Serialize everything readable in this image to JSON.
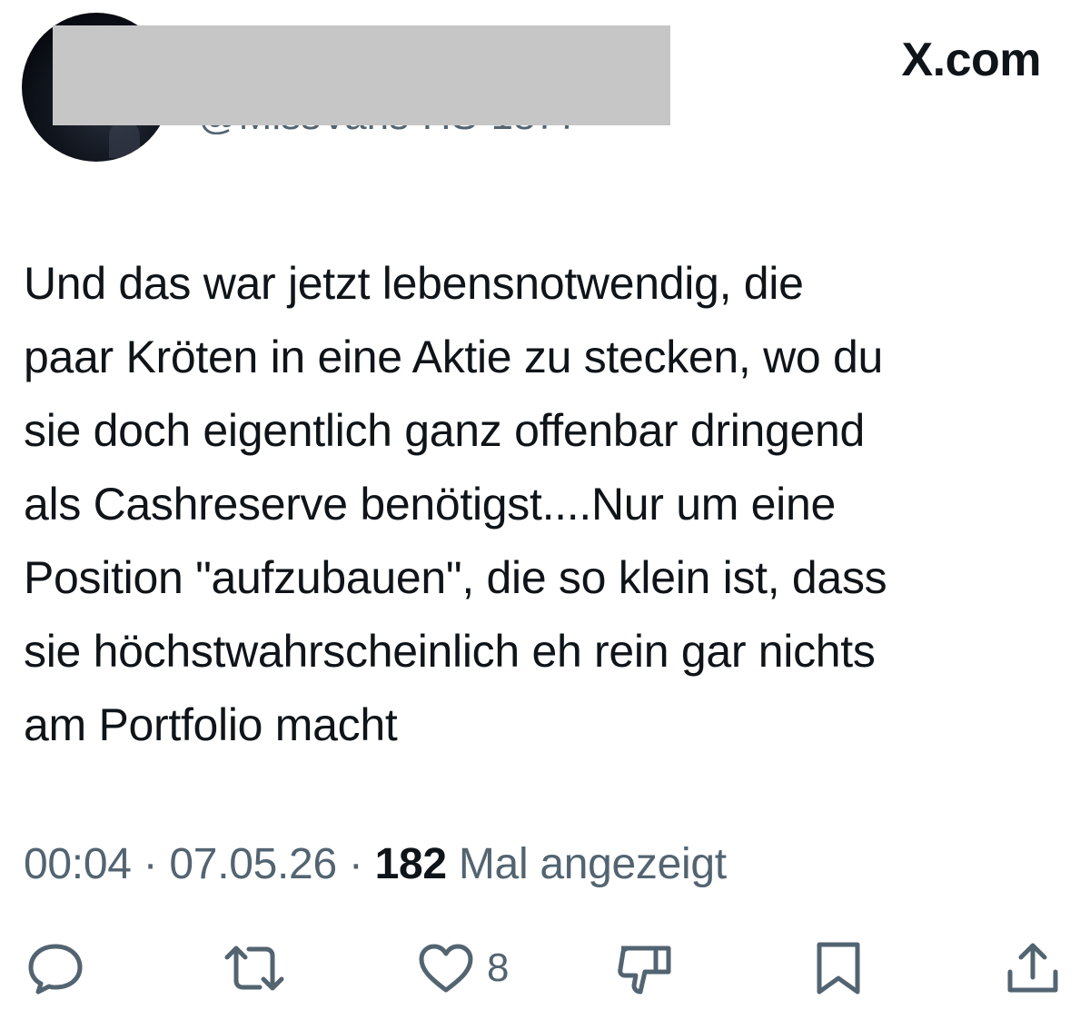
{
  "header": {
    "handle": "@MissVans-HS-1877",
    "brand": "X.com"
  },
  "tweet": {
    "text": "Und das war jetzt lebensnotwendig, die\npaar Kröten in eine Aktie zu stecken, wo du\nsie doch eigentlich ganz offenbar dringend\nals Cashreserve benötigst....Nur um eine\nPosition \"aufzubauen\", die so klein ist, dass\nsie höchstwahrscheinlich eh rein gar nichts\nam Portfolio macht",
    "time": "00:04",
    "sep": "·",
    "date": "07.05.26",
    "views_count": "182",
    "views_label": "Mal angezeigt"
  },
  "actions": {
    "reply_icon": "reply-bubble-icon",
    "retweet_icon": "retweet-icon",
    "like_icon": "heart-icon",
    "like_count": "8",
    "dislike_icon": "thumbs-down-icon",
    "bookmark_icon": "bookmark-icon",
    "share_icon": "share-upload-icon"
  },
  "colors": {
    "text": "#0f1419",
    "secondary": "#536471",
    "background": "#ffffff",
    "redaction": "#c6c6c6"
  }
}
